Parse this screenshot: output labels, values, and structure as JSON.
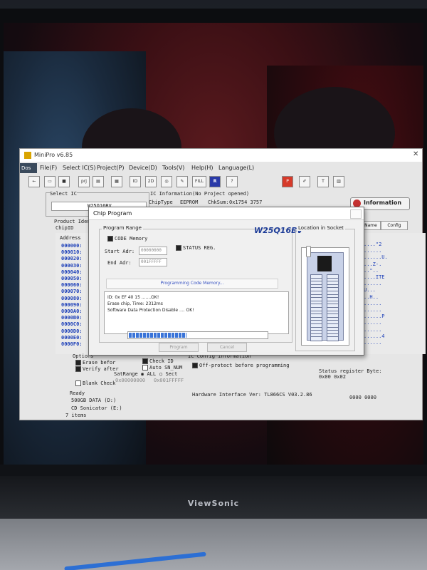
{
  "monitor": {
    "brand": "ViewSonic"
  },
  "window": {
    "title": "MiniPro v6.85",
    "menu": [
      "File(F)",
      "Select IC(S)",
      "Project(P)",
      "Device(D)",
      "Tools(V)",
      "Help(H)",
      "Language(L)"
    ],
    "dos_label": "Dos",
    "toolbar_icons": [
      "prj",
      "ID",
      "2D",
      "FILL",
      "R"
    ],
    "select_ic_label": "Select IC",
    "select_ic_value": "W25Q16BV",
    "ic_info_label": "IC Information(No Project opened)",
    "chiptype_label": "ChipType",
    "chiptype_value": "EEPROM",
    "chksum_label": "ChkSum:",
    "chksum_value": "0x1754 3757",
    "information_button": "Information",
    "product_ident_label": "Product Ident",
    "chipid_label": "ChipID",
    "address_header": "Address",
    "tabs": [
      "Name",
      "Config"
    ],
    "addresses": [
      "000000:",
      "000010:",
      "000020:",
      "000030:",
      "000040:",
      "000050:",
      "000060:",
      "000070:",
      "000080:",
      "000090:",
      "0000A0:",
      "0000B0:",
      "0000C0:",
      "0000D0:",
      "0000E0:",
      "0000F0:"
    ],
    "ascii_rows": [
      "....\"2",
      "......",
      "......U.",
      "...Z-.",
      "..\"..",
      "....ITE",
      "......",
      "U...",
      "..H..",
      "......",
      "......",
      "......P",
      "......",
      "......",
      "......4",
      "......"
    ],
    "options": {
      "title": "Options",
      "erase_before": "Erase befor",
      "verify_after": "Verify after",
      "blank_check": "Blank Check",
      "check_id": "Check ID",
      "auto_sn_num": "Auto SN_NUM",
      "sat_range": "SatRange",
      "all": "ALL",
      "sect": "Sect",
      "range_from": "0x00000000",
      "range_to": "0x001FFFFF"
    },
    "ic_config": {
      "title": "IC Config information",
      "off_protect": "Off-protect before programming",
      "status_register_label": "Status register Byte:",
      "status_register_values": "0x00 0x02"
    },
    "status": {
      "ready": "Ready",
      "hardware": "Hardware Interface Ver: TL866CS V03.2.86",
      "counter": "0000 0000"
    },
    "explorer": {
      "drive1": "500GB DATA (D:)",
      "drive2": "CD Sonicator (E:)",
      "items": "7 items"
    }
  },
  "dialog": {
    "title": "Chip Program",
    "chip_name": "W25Q16BV",
    "program_range_label": "Program Range",
    "code_memory": "CODE Memory",
    "status_reg": "STATUS REG.",
    "start_adr_label": "Start Adr:",
    "start_adr_value": "00000000",
    "end_adr_label": "End Adr:",
    "end_adr_value": "001FFFFF",
    "location_label": "Location in Socket",
    "progress_title": "Programming Code Memory...",
    "log": [
      "ID: 0x EF 40 15 .......OK!",
      "Erase chip, Time: 2312ms",
      "Software Data Protection Disable .... OK!"
    ],
    "progress_fraction": 0.42,
    "program_button": "Program",
    "cancel_button": "Cancel"
  }
}
